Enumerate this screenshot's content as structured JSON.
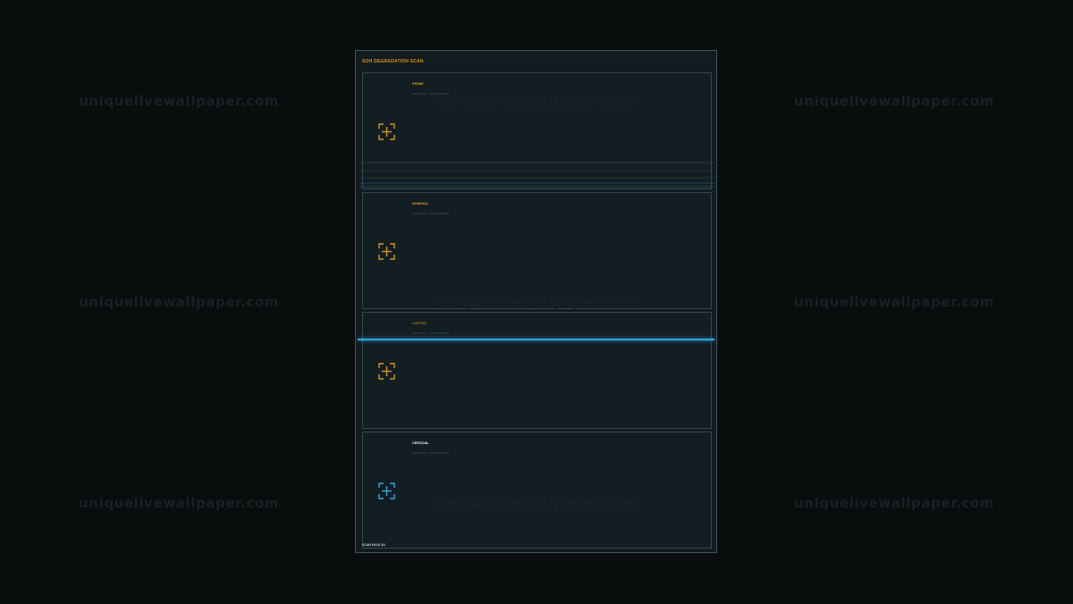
{
  "panel": {
    "title": "SOH DEGRADATION SCAN",
    "footer": "SCAN PASS 3/4",
    "cards": [
      {
        "name": "PRIME",
        "subtitle": "INTEGRITY · SCAN NOMINAL",
        "icon": "focus-brackets-icon",
        "name_color": "#d9921f",
        "icon_color": "#d9921f"
      },
      {
        "name": "NOMINAL",
        "subtitle": "INTEGRITY · SCAN NOMINAL",
        "icon": "focus-brackets-icon",
        "name_color": "#d9921f",
        "icon_color": "#d9921f"
      },
      {
        "name": "LIMITED",
        "subtitle": "INTEGRITY · SCAN NOMINAL",
        "icon": "focus-brackets-icon",
        "name_color": "#d9921f",
        "icon_color": "#d9921f"
      },
      {
        "name": "CRITICAL",
        "subtitle": "INTEGRITY · SCAN NOMINAL",
        "icon": "focus-brackets-icon",
        "name_color": "#ffffff",
        "icon_color": "#2ea7e0"
      }
    ]
  },
  "watermark": "uniquelivewallpaper.com",
  "colors": {
    "background": "#0a0d0e",
    "panel": "#111b20",
    "accent_amber": "#d9921f",
    "accent_cyan": "#2ea7e0"
  }
}
